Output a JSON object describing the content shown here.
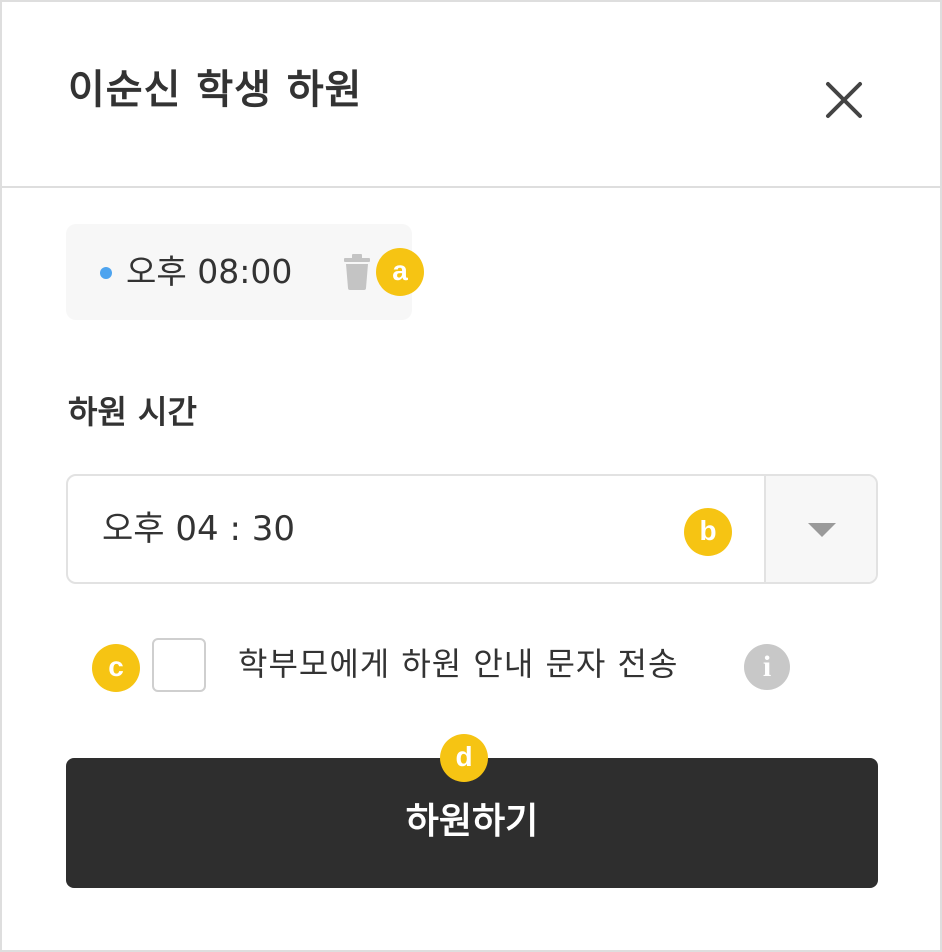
{
  "dialog": {
    "title": "이순신 학생 하원",
    "close_icon": "close-icon"
  },
  "schedule_chip": {
    "time": "오후 08:00",
    "dot_color": "#4ea4ef",
    "delete_icon": "trash-icon"
  },
  "dismissal_time": {
    "label": "하원 시간",
    "value": "오후 04 : 30",
    "dropdown_icon": "caret-down-icon"
  },
  "notify_parents": {
    "label": "학부모에게 하원 안내 문자 전송",
    "checked": false,
    "info_icon": "info-icon",
    "info_glyph": "i"
  },
  "submit": {
    "label": "하원하기"
  },
  "annotations": {
    "a": "a",
    "b": "b",
    "c": "c",
    "d": "d",
    "color": "#f6c413"
  },
  "colors": {
    "text": "#333333",
    "border": "#dedede",
    "button_bg": "#2e2e2e",
    "chip_bg": "#f7f7f7"
  }
}
